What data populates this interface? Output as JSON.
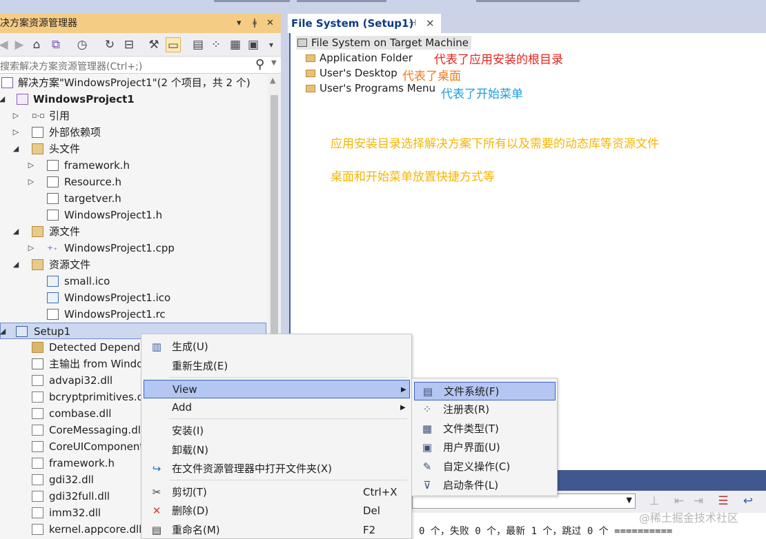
{
  "solution_explorer": {
    "title": "决方案资源管理器",
    "title_buttons": [
      "▾",
      "ǂ",
      "✕"
    ],
    "search_placeholder": "搜索解决方案资源管理器(Ctrl+;)",
    "tree": [
      {
        "label": "解决方案\"WindowsProject1\"(2 个项目，共 2 个)",
        "icon": "solution-icon",
        "depth": 0,
        "expander": ""
      },
      {
        "label": "WindowsProject1",
        "icon": "project-icon",
        "depth": 0,
        "expander": "◢",
        "bold": true
      },
      {
        "label": "引用",
        "icon": "reference-icon",
        "depth": 1,
        "expander": "▷"
      },
      {
        "label": "外部依赖项",
        "icon": "dependency-icon",
        "depth": 1,
        "expander": "▷"
      },
      {
        "label": "头文件",
        "icon": "filter-folder-icon",
        "depth": 1,
        "expander": "◢"
      },
      {
        "label": "framework.h",
        "icon": "header-file-icon",
        "depth": 2,
        "expander": "▷"
      },
      {
        "label": "Resource.h",
        "icon": "header-file-icon",
        "depth": 2,
        "expander": "▷"
      },
      {
        "label": "targetver.h",
        "icon": "header-file-icon",
        "depth": 2,
        "expander": ""
      },
      {
        "label": "WindowsProject1.h",
        "icon": "header-file-icon",
        "depth": 2,
        "expander": ""
      },
      {
        "label": "源文件",
        "icon": "filter-folder-icon",
        "depth": 1,
        "expander": "◢"
      },
      {
        "label": "WindowsProject1.cpp",
        "icon": "cpp-file-icon",
        "depth": 2,
        "expander": "▷"
      },
      {
        "label": "资源文件",
        "icon": "filter-folder-icon",
        "depth": 1,
        "expander": "◢"
      },
      {
        "label": "small.ico",
        "icon": "image-file-icon",
        "depth": 2,
        "expander": ""
      },
      {
        "label": "WindowsProject1.ico",
        "icon": "image-file-icon",
        "depth": 2,
        "expander": ""
      },
      {
        "label": "WindowsProject1.rc",
        "icon": "resource-file-icon",
        "depth": 2,
        "expander": ""
      },
      {
        "label": "Setup1",
        "icon": "setup-project-icon",
        "depth": 0,
        "expander": "◢",
        "selected": true
      },
      {
        "label": "Detected Depende",
        "icon": "folder-icon",
        "depth": 1,
        "expander": ""
      },
      {
        "label": "主输出 from Windo",
        "icon": "output-icon",
        "depth": 1,
        "expander": ""
      },
      {
        "label": "advapi32.dll",
        "icon": "dll-file-icon",
        "depth": 1,
        "expander": ""
      },
      {
        "label": "bcryptprimitives.d",
        "icon": "dll-file-icon",
        "depth": 1,
        "expander": ""
      },
      {
        "label": "combase.dll",
        "icon": "dll-file-icon",
        "depth": 1,
        "expander": ""
      },
      {
        "label": "CoreMessaging.dl",
        "icon": "dll-file-icon",
        "depth": 1,
        "expander": ""
      },
      {
        "label": "CoreUIComponent",
        "icon": "dll-file-icon",
        "depth": 1,
        "expander": ""
      },
      {
        "label": "framework.h",
        "icon": "dll-file-icon",
        "depth": 1,
        "expander": ""
      },
      {
        "label": "gdi32.dll",
        "icon": "dll-file-icon",
        "depth": 1,
        "expander": ""
      },
      {
        "label": "gdi32full.dll",
        "icon": "dll-file-icon",
        "depth": 1,
        "expander": ""
      },
      {
        "label": "imm32.dll",
        "icon": "dll-file-icon",
        "depth": 1,
        "expander": ""
      },
      {
        "label": "kernel.appcore.dll",
        "icon": "dll-file-icon",
        "depth": 1,
        "expander": ""
      }
    ]
  },
  "editor": {
    "tab_title": "File System (Setup1)",
    "tab_pin": "⊣",
    "tab_close": "✕",
    "root_label": "File System on Target Machine",
    "folders": [
      "Application Folder",
      "User's Desktop",
      "User's Programs Menu"
    ],
    "notes": {
      "app_folder": "代表了应用安装的根目录",
      "desktop": "代表了桌面",
      "programs_menu": "代表了开始菜单",
      "line1": "应用安装目录选择解决方案下所有以及需要的动态库等资源文件",
      "line2": "桌面和开始菜单放置快捷方式等"
    },
    "colors": {
      "red": "#e8231c",
      "orange": "#f07a1a",
      "blue": "#1a9cde",
      "yellow": "#f7b500"
    }
  },
  "context_menu": {
    "items": [
      {
        "label": "生成(U)",
        "icon": "build-icon",
        "shortcut": ""
      },
      {
        "label": "重新生成(E)",
        "icon": "",
        "shortcut": ""
      },
      {
        "label": "View",
        "icon": "",
        "shortcut": "",
        "submenu": true,
        "highlighted": true
      },
      {
        "label": "Add",
        "icon": "",
        "shortcut": "",
        "submenu": true
      },
      {
        "label": "安装(I)",
        "icon": "",
        "shortcut": ""
      },
      {
        "label": "卸载(N)",
        "icon": "",
        "shortcut": ""
      },
      {
        "label": "在文件资源管理器中打开文件夹(X)",
        "icon": "open-folder-icon",
        "shortcut": ""
      },
      {
        "label": "剪切(T)",
        "icon": "cut-icon",
        "shortcut": "Ctrl+X"
      },
      {
        "label": "删除(D)",
        "icon": "delete-icon",
        "shortcut": "Del"
      },
      {
        "label": "重命名(M)",
        "icon": "rename-icon",
        "shortcut": "F2"
      }
    ],
    "submenu_arrow": "▶"
  },
  "view_submenu": {
    "items": [
      {
        "label": "文件系统(F)",
        "icon": "file-system-icon",
        "highlighted": true
      },
      {
        "label": "注册表(R)",
        "icon": "registry-icon"
      },
      {
        "label": "文件类型(T)",
        "icon": "file-types-icon"
      },
      {
        "label": "用户界面(U)",
        "icon": "user-interface-icon"
      },
      {
        "label": "自定义操作(C)",
        "icon": "custom-actions-icon"
      },
      {
        "label": "启动条件(L)",
        "icon": "launch-conditions-icon"
      }
    ]
  },
  "output": {
    "text": "0 个，失败 0 个，最新 1 个，跳过 0 个 =========="
  },
  "watermark": "@稀土掘金技术社区"
}
